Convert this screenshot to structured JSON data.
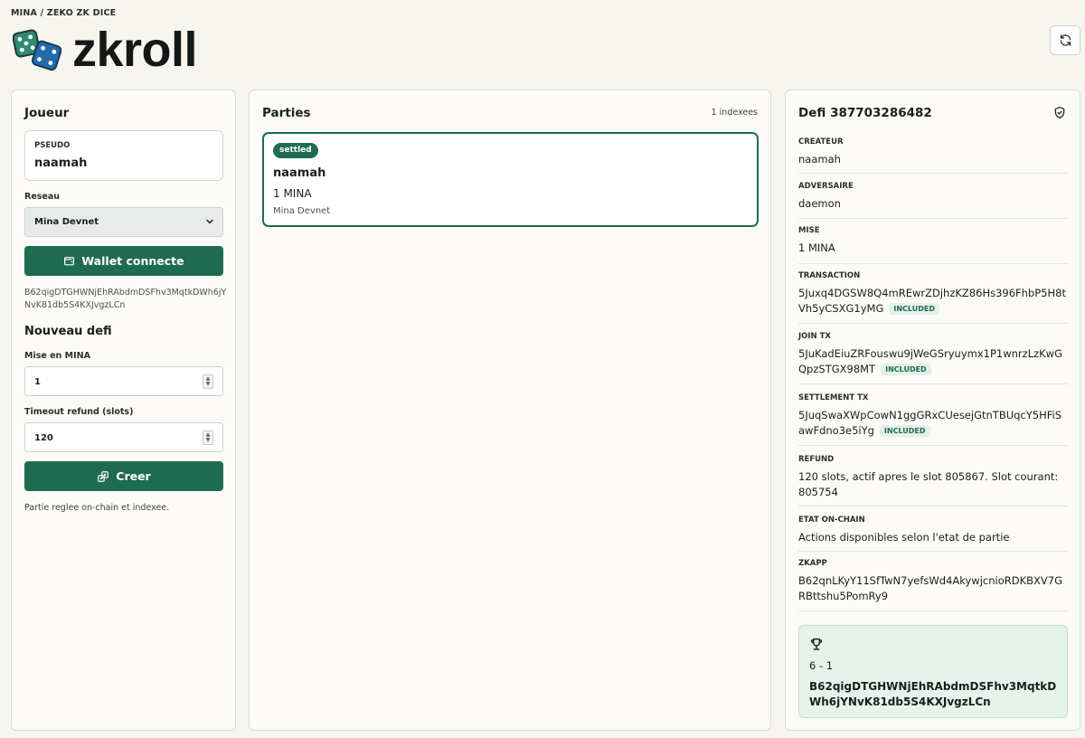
{
  "header": {
    "breadcrumb": "MINA / ZEKO ZK DICE",
    "app_title": "zkroll",
    "logo_icon": "dice-icon",
    "refresh_icon": "refresh-icon"
  },
  "player": {
    "title": "Joueur",
    "pseudo_label": "PSEUDO",
    "pseudo_value": "naamah",
    "network_label": "Reseau",
    "network_value": "Mina Devnet",
    "wallet_button": "Wallet connecte",
    "wallet_address": "B62qigDTGHWNjEhRAbdmDSFhv3MqtkDWh6jYNvK81db5S4KXJvgzLCn",
    "new_challenge_title": "Nouveau defi",
    "stake_label": "Mise en MINA",
    "stake_value": "1",
    "timeout_label": "Timeout refund (slots)",
    "timeout_value": "120",
    "create_button": "Creer",
    "footnote": "Partie reglee on-chain et indexee."
  },
  "games": {
    "title": "Parties",
    "count_label": "1 indexees",
    "items": [
      {
        "status": "settled",
        "player": "naamah",
        "stake": "1 MINA",
        "network": "Mina Devnet"
      }
    ]
  },
  "detail": {
    "title": "Defi 387703286482",
    "creator_label": "CREATEUR",
    "creator_value": "naamah",
    "opponent_label": "ADVERSAIRE",
    "opponent_value": "daemon",
    "stake_label": "MISE",
    "stake_value": "1 MINA",
    "tx_label": "TRANSACTION",
    "tx_value": "5Juxq4DGSW8Q4mREwrZDjhzKZ86Hs396FhbP5H8tVh5yCSXG1yMG",
    "tx_status": "INCLUDED",
    "join_label": "JOIN TX",
    "join_value": "5JuKadEiuZRFouswu9jWeGSryuymx1P1wnrzLzKwGQpzSTGX98MT",
    "join_status": "INCLUDED",
    "settle_label": "SETTLEMENT TX",
    "settle_value": "5JuqSwaXWpCowN1ggGRxCUesejGtnTBUqcY5HFiSawFdno3e5iYg",
    "settle_status": "INCLUDED",
    "refund_label": "REFUND",
    "refund_value": "120 slots, actif apres le slot 805867. Slot courant: 805754",
    "state_label": "ETAT ON-CHAIN",
    "state_value": "Actions disponibles selon l'etat de partie",
    "zkapp_label": "ZKAPP",
    "zkapp_value": "B62qnLKyY11SfTwN7yefsWd4AkywjcnioRDKBXV7GRBttshu5PomRy9",
    "result_score": "6 - 1",
    "winner_address": "B62qigDTGHWNjEhRAbdmDSFhv3MqtkDWh6jYNvK81db5S4KXJvgzLCn"
  },
  "colors": {
    "accent": "#1f6b52",
    "background": "#f6f5f0",
    "panel": "#fcfbf7",
    "winner_bg": "#e6f2ec",
    "dice_green": "#2e8b6f",
    "dice_blue": "#236ba8"
  }
}
